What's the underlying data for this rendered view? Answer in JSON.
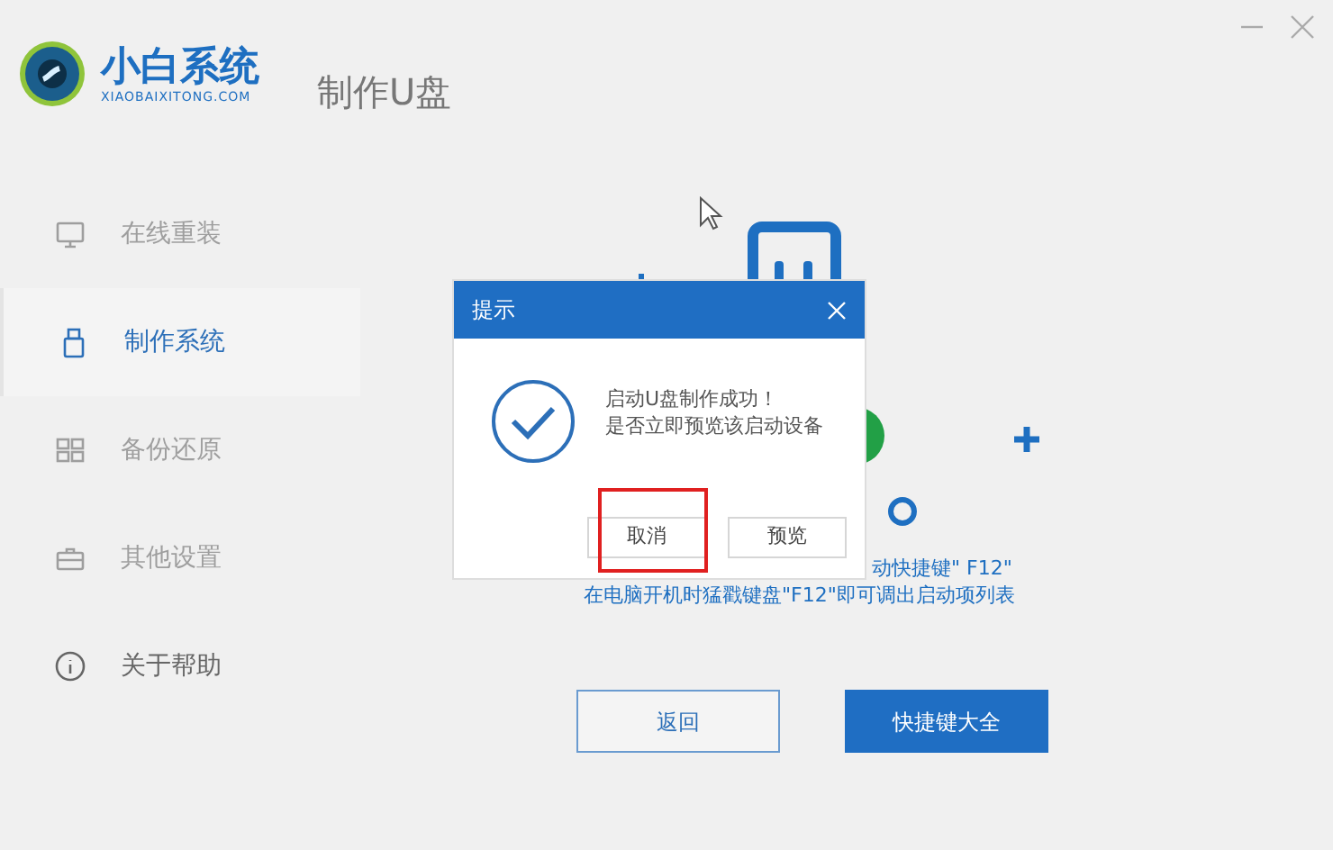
{
  "header": {
    "brand": "小白系统",
    "brand_url": "XIAOBAIXITONG.COM",
    "title": "制作U盘"
  },
  "sidebar": {
    "items": [
      {
        "label": "在线重装",
        "kind": "monitor",
        "selected": false,
        "disabled": true
      },
      {
        "label": "制作系统",
        "kind": "usb",
        "selected": true,
        "disabled": false
      },
      {
        "label": "备份还原",
        "kind": "grid",
        "selected": false,
        "disabled": true
      },
      {
        "label": "其他设置",
        "kind": "case",
        "selected": false,
        "disabled": true
      },
      {
        "label": "关于帮助",
        "kind": "info",
        "selected": false,
        "disabled": false
      }
    ]
  },
  "hint_lines": [
    "动快捷键\" F12\"",
    "在电脑开机时猛戳键盘\"F12\"即可调出启动项列表"
  ],
  "dialog": {
    "title": "提示",
    "message": [
      "启动U盘制作成功！",
      "是否立即预览该启动设备"
    ],
    "buttons": [
      {
        "label": "取消",
        "highlighted": true
      },
      {
        "label": "预览",
        "highlighted": false
      }
    ]
  },
  "buttons": [
    {
      "label": "返回",
      "kind": "outline"
    },
    {
      "label": "快捷键大全",
      "kind": "primary"
    }
  ]
}
